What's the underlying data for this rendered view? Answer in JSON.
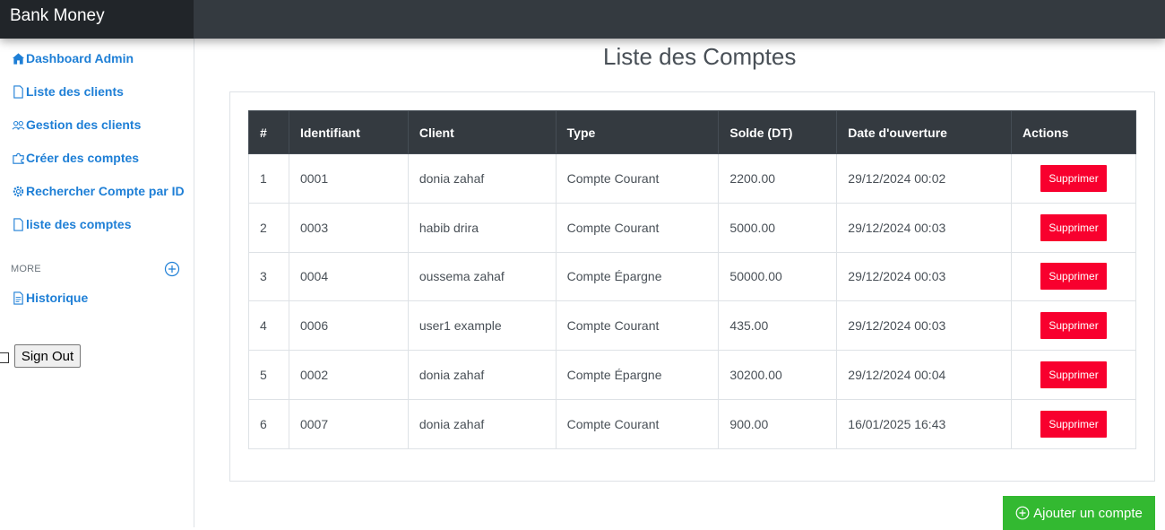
{
  "app": {
    "brand": "Bank Money"
  },
  "sidebar": {
    "items": [
      {
        "label": "Dashboard Admin",
        "icon": "home-icon"
      },
      {
        "label": "Liste des clients",
        "icon": "file-icon"
      },
      {
        "label": "Gestion des clients",
        "icon": "people-icon"
      },
      {
        "label": "Créer des comptes",
        "icon": "puzzle-icon"
      },
      {
        "label": "Rechercher Compte par ID",
        "icon": "gear-icon"
      },
      {
        "label": "liste des comptes",
        "icon": "file-icon"
      }
    ],
    "more_label": "MORE",
    "more_items": [
      {
        "label": "Historique",
        "icon": "file-text-icon"
      }
    ],
    "signout_label": "Sign Out"
  },
  "main": {
    "title": "Liste des Comptes",
    "table": {
      "headers": [
        "#",
        "Identifiant",
        "Client",
        "Type",
        "Solde (DT)",
        "Date d'ouverture",
        "Actions"
      ],
      "rows": [
        [
          "1",
          "0001",
          "donia zahaf",
          "Compte Courant",
          "2200.00",
          "29/12/2024 00:02"
        ],
        [
          "2",
          "0003",
          "habib drira",
          "Compte Courant",
          "5000.00",
          "29/12/2024 00:03"
        ],
        [
          "3",
          "0004",
          "oussema zahaf",
          "Compte Épargne",
          "50000.00",
          "29/12/2024 00:03"
        ],
        [
          "4",
          "0006",
          "user1 example",
          "Compte Courant",
          "435.00",
          "29/12/2024 00:03"
        ],
        [
          "5",
          "0002",
          "donia zahaf",
          "Compte Épargne",
          "30200.00",
          "29/12/2024 00:04"
        ],
        [
          "6",
          "0007",
          "donia zahaf",
          "Compte Courant",
          "900.00",
          "16/01/2025 16:43"
        ]
      ],
      "delete_label": "Supprimer"
    },
    "add_button_label": "Ajouter un compte"
  },
  "colors": {
    "accent": "#1e7fd6",
    "topbar": "#343a40",
    "brand_bg": "#212529",
    "danger": "#f8002e",
    "success": "#33b931"
  }
}
